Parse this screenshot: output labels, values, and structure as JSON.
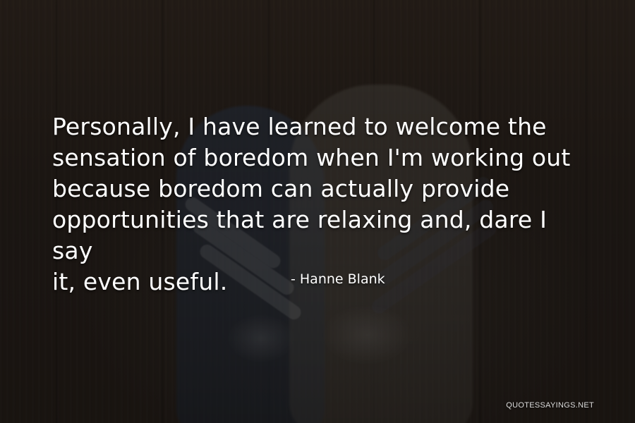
{
  "quote": {
    "text": "Personally, I have learned to welcome the\nsensation of boredom when I'm working out\nbecause boredom can actually provide\nopportunities that are relaxing and, dare I say\nit, even useful.",
    "attribution": "- Hanne Blank"
  },
  "watermark": {
    "text": "QUOTESSAYINGS.NET"
  },
  "background": {
    "scene": "two-sneakers-on-wood-floor",
    "colors": {
      "wood": "#2f2620",
      "overlay": "#000000",
      "text": "#ffffff"
    }
  }
}
